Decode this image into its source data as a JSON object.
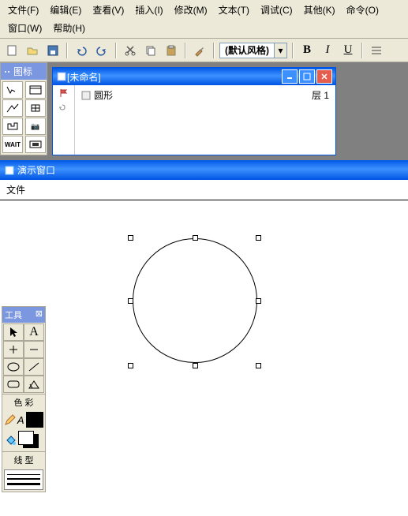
{
  "menu": {
    "file": "文件(F)",
    "edit": "编辑(E)",
    "view": "查看(V)",
    "insert": "插入(I)",
    "modify": "修改(M)",
    "text": "文本(T)",
    "debug": "调试(C)",
    "other": "其他(K)",
    "command": "命令(O)",
    "window": "窗口(W)",
    "help": "帮助(H)"
  },
  "combo": {
    "style": "(默认风格)"
  },
  "format": {
    "bold": "B",
    "italic": "I",
    "underline": "U"
  },
  "icon_panel": {
    "title": "图标"
  },
  "doc": {
    "title": "[未命名]",
    "layer": "层 1",
    "item": "圆形"
  },
  "presentation": {
    "title": "演示窗口",
    "file": "文件"
  },
  "tools": {
    "title": "工具",
    "close": "⊠",
    "arrow": "▲",
    "text": "A",
    "color_label": "色 彩",
    "line_label": "线 型",
    "a_label": "A"
  }
}
